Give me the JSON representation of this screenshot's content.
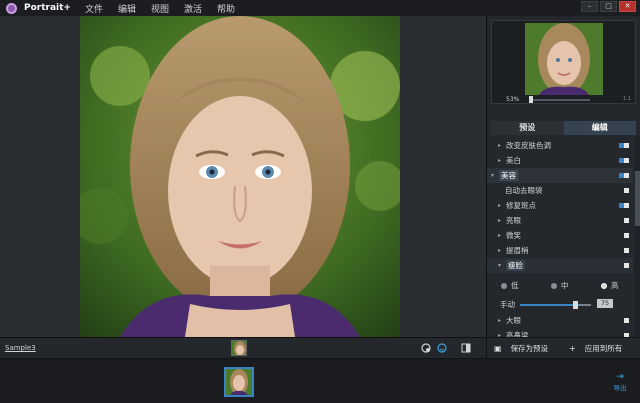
{
  "app": {
    "title": "Portrait+"
  },
  "menu": [
    "文件",
    "编辑",
    "视图",
    "激活",
    "帮助"
  ],
  "window_buttons": [
    "–",
    "□",
    "✕"
  ],
  "navigator": {
    "zoom": "53%",
    "zoom_max": "1:1"
  },
  "tabs": [
    {
      "label": "预设",
      "active": false
    },
    {
      "label": "编辑",
      "active": true
    }
  ],
  "adjustments": [
    {
      "label": "改变皮肤色调",
      "arrow": "▸",
      "toggle": "on"
    },
    {
      "label": "美白",
      "arrow": "▸",
      "toggle": "on"
    },
    {
      "label": "美容",
      "arrow": "▾",
      "toggle": "on",
      "section": true
    },
    {
      "label": "自动去眼袋",
      "arrow": "",
      "toggle": "off"
    },
    {
      "label": "修复斑点",
      "arrow": "▸",
      "toggle": "on"
    },
    {
      "label": "亮眼",
      "arrow": "▸",
      "toggle": "off"
    },
    {
      "label": "微笑",
      "arrow": "▸",
      "toggle": "off"
    },
    {
      "label": "提眉梢",
      "arrow": "▸",
      "toggle": "off"
    },
    {
      "label": "瘦脸",
      "arrow": "▾",
      "toggle": "off",
      "highlight": true
    }
  ],
  "slim_face": {
    "options": [
      {
        "label": "低",
        "selected": false
      },
      {
        "label": "中",
        "selected": false
      },
      {
        "label": "高",
        "selected": true
      }
    ],
    "manual_label": "手动",
    "manual_value": "75"
  },
  "adjustments_more": [
    {
      "label": "大眼",
      "arrow": "▸",
      "toggle": "off"
    },
    {
      "label": "高鼻梁",
      "arrow": "▸",
      "toggle": "off"
    }
  ],
  "bottom": {
    "sample_name": "Sample3",
    "save_preset": "保存为预设",
    "apply_all": "应用到所有",
    "save_icon": "save-icon",
    "add_icon": "plus-icon"
  },
  "filmstrip": {
    "export_label": "导出"
  }
}
